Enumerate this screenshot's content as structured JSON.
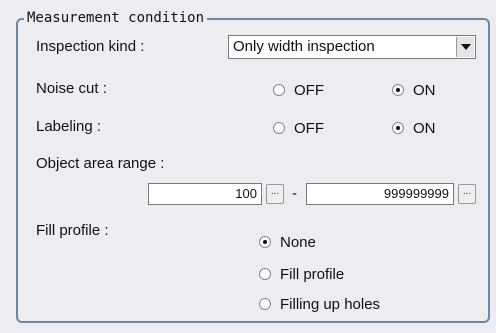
{
  "group_title": "Measurement condition",
  "inspection_kind": {
    "label": "Inspection kind :",
    "selected": "Only width inspection"
  },
  "noise_cut": {
    "label": "Noise cut :",
    "off": "OFF",
    "on": "ON",
    "value": "ON"
  },
  "labeling": {
    "label": "Labeling :",
    "off": "OFF",
    "on": "ON",
    "value": "ON"
  },
  "object_area_range": {
    "label": "Object area range :",
    "min": "100",
    "separator": "-",
    "max": "999999999",
    "browse": "..."
  },
  "fill_profile": {
    "label": "Fill profile :",
    "options": [
      "None",
      "Fill profile",
      "Filling up holes"
    ],
    "value": "None"
  }
}
